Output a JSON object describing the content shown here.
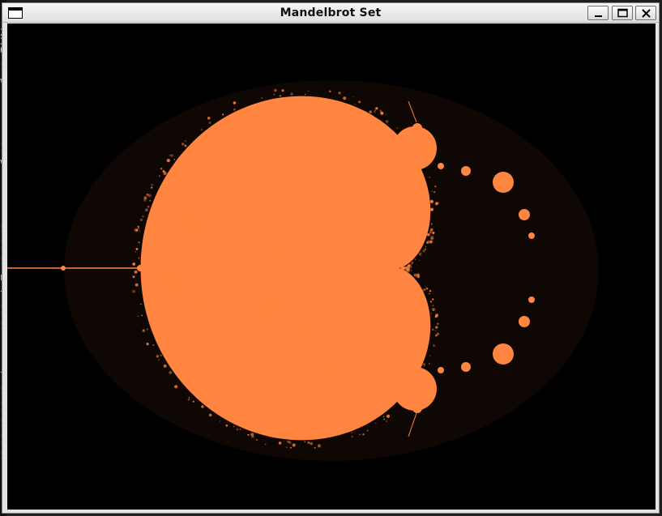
{
  "window": {
    "title": "Mandelbrot Set",
    "buttons": {
      "minimize": "minimize",
      "maximize": "maximize",
      "close": "close"
    }
  },
  "background_terminal": {
    "glyphs": [
      "2",
      "2",
      "0",
      "1",
      "V",
      "1",
      "V",
      "1",
      "1",
      "1",
      "n",
      "t",
      "1",
      "1",
      "t",
      "1",
      "1",
      "1",
      "1",
      "1"
    ]
  },
  "fractal": {
    "fill_color": "#ff8540",
    "background_color": "#000000",
    "halo_color": "#1a0d05"
  }
}
